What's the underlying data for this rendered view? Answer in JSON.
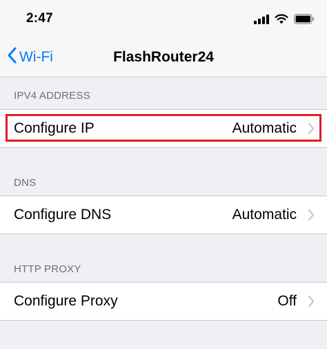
{
  "status_bar": {
    "time": "2:47",
    "icons": [
      "signal-icon",
      "wifi-icon",
      "battery-icon"
    ]
  },
  "nav": {
    "back_label": "Wi-Fi",
    "back_icon": "chevron-left-icon",
    "title": "FlashRouter24"
  },
  "sections": [
    {
      "header": "IPV4 ADDRESS",
      "row": {
        "label": "Configure IP",
        "value": "Automatic",
        "icon": "chevron-right-icon"
      }
    },
    {
      "header": "DNS",
      "row": {
        "label": "Configure DNS",
        "value": "Automatic",
        "icon": "chevron-right-icon"
      }
    },
    {
      "header": "HTTP PROXY",
      "row": {
        "label": "Configure Proxy",
        "value": "Off",
        "icon": "chevron-right-icon"
      }
    }
  ],
  "colors": {
    "accent": "#007aff",
    "highlight": "#e31b23",
    "background": "#efeff4",
    "header_text": "#6d6d72",
    "chevron": "#c7c7cc"
  }
}
